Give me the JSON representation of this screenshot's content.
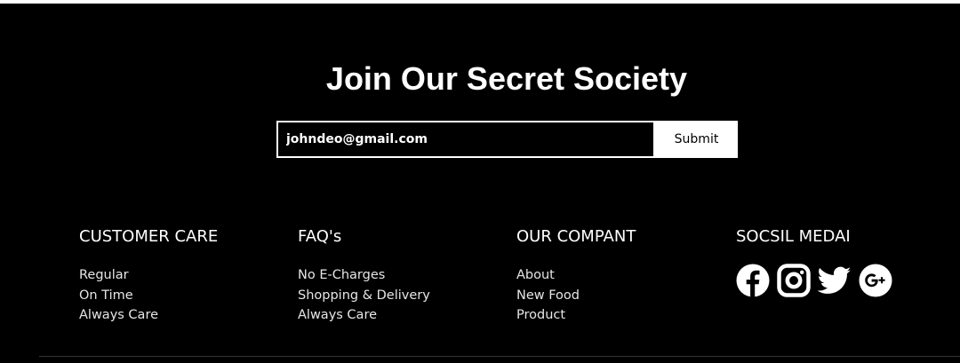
{
  "newsletter": {
    "title": "Join Our Secret Society",
    "email_value": "johndeo@gmail.com",
    "submit_label": "Submit"
  },
  "columns": [
    {
      "heading": "CUSTOMER CARE",
      "links": [
        "Regular",
        "On Time",
        "Always Care"
      ]
    },
    {
      "heading": "FAQ's",
      "links": [
        "No E-Charges",
        "Shopping & Delivery",
        "Always Care"
      ]
    },
    {
      "heading": "OUR COMPANT",
      "links": [
        "About",
        "New Food",
        "Product"
      ]
    }
  ],
  "social": {
    "heading": "SOCSIL MEDAI",
    "icons": [
      "facebook-icon",
      "instagram-icon",
      "twitter-icon",
      "google-plus-icon"
    ]
  },
  "colors": {
    "background": "#000000",
    "text": "#ffffff",
    "button_bg": "#ffffff"
  }
}
